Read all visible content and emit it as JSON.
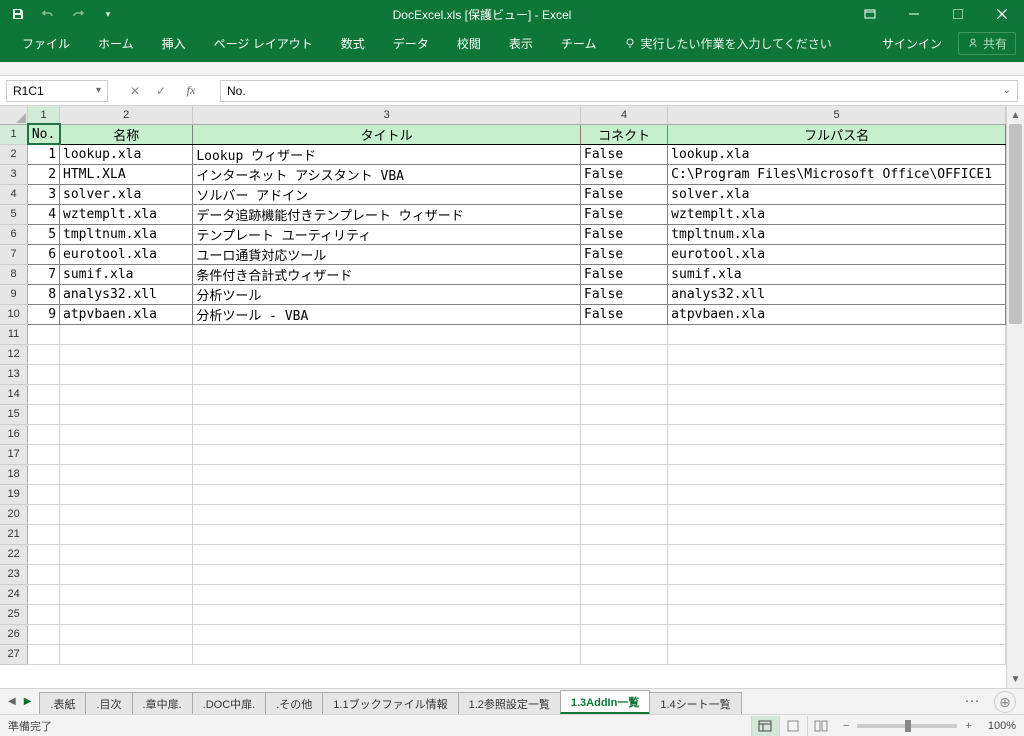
{
  "title": "DocExcel.xls  [保護ビュー] - Excel",
  "ribbon": {
    "tabs": [
      "ファイル",
      "ホーム",
      "挿入",
      "ページ レイアウト",
      "数式",
      "データ",
      "校閲",
      "表示",
      "チーム"
    ],
    "tellme": "実行したい作業を入力してください",
    "signin": "サインイン",
    "share": "共有"
  },
  "namebox": "R1C1",
  "formula": "No.",
  "col_headers": [
    "1",
    "2",
    "3",
    "4",
    "5"
  ],
  "table_headers": [
    "No.",
    "名称",
    "タイトル",
    "コネクト",
    "フルパス名"
  ],
  "rows": [
    {
      "no": "1",
      "name": "lookup.xla",
      "title": "Lookup ウィザード",
      "connect": "False",
      "path": "lookup.xla"
    },
    {
      "no": "2",
      "name": "HTML.XLA",
      "title": "インターネット アシスタント VBA",
      "connect": "False",
      "path": "C:\\Program Files\\Microsoft Office\\OFFICE1"
    },
    {
      "no": "3",
      "name": "solver.xla",
      "title": "ソルバー アドイン",
      "connect": "False",
      "path": "solver.xla"
    },
    {
      "no": "4",
      "name": "wztemplt.xla",
      "title": "データ追跡機能付きテンプレート ウィザード",
      "connect": "False",
      "path": "wztemplt.xla"
    },
    {
      "no": "5",
      "name": "tmpltnum.xla",
      "title": "テンプレート ユーティリティ",
      "connect": "False",
      "path": "tmpltnum.xla"
    },
    {
      "no": "6",
      "name": "eurotool.xla",
      "title": "ユーロ通貨対応ツール",
      "connect": "False",
      "path": "eurotool.xla"
    },
    {
      "no": "7",
      "name": "sumif.xla",
      "title": "条件付き合計式ウィザード",
      "connect": "False",
      "path": "sumif.xla"
    },
    {
      "no": "8",
      "name": "analys32.xll",
      "title": "分析ツール",
      "connect": "False",
      "path": "analys32.xll"
    },
    {
      "no": "9",
      "name": "atpvbaen.xla",
      "title": "分析ツール - VBA",
      "connect": "False",
      "path": "atpvbaen.xla"
    }
  ],
  "empty_rows": [
    "11",
    "12",
    "13",
    "14",
    "15",
    "16",
    "17",
    "18",
    "19",
    "20",
    "21",
    "22",
    "23",
    "24",
    "25",
    "26",
    "27"
  ],
  "sheet_tabs": [
    ".表紙",
    ".目次",
    ".章中扉.",
    ".DOC中扉.",
    ".その他",
    "1.1ブックファイル情報",
    "1.2参照設定一覧",
    "1.3AddIn一覧",
    "1.4シート一覧"
  ],
  "active_sheet_index": 7,
  "status": "準備完了",
  "zoom": "100%"
}
